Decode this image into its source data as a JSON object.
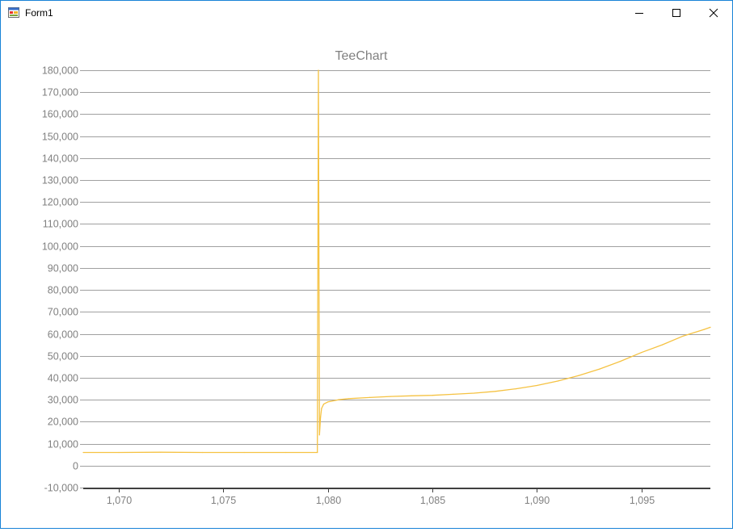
{
  "window": {
    "title": "Form1",
    "icon": "winforms-app-icon",
    "controls": [
      "minimize-icon",
      "maximize-icon",
      "close-icon"
    ],
    "border_color": "#1883d7"
  },
  "chart_data": {
    "type": "line",
    "title": "TeeChart",
    "xlabel": "",
    "ylabel": "",
    "xlim": [
      1068.3,
      1098.3
    ],
    "ylim": [
      -10000,
      180000
    ],
    "x_ticks": [
      1070,
      1075,
      1080,
      1085,
      1090,
      1095
    ],
    "x_tick_labels": [
      "1,070",
      "1,075",
      "1,080",
      "1,085",
      "1,090",
      "1,095"
    ],
    "y_ticks": [
      -10000,
      0,
      10000,
      20000,
      30000,
      40000,
      50000,
      60000,
      70000,
      80000,
      90000,
      100000,
      110000,
      120000,
      130000,
      140000,
      150000,
      160000,
      170000,
      180000
    ],
    "y_tick_labels": [
      "-10,000",
      "0",
      "10,000",
      "20,000",
      "30,000",
      "40,000",
      "50,000",
      "60,000",
      "70,000",
      "80,000",
      "90,000",
      "100,000",
      "110,000",
      "120,000",
      "130,000",
      "140,000",
      "150,000",
      "160,000",
      "170,000",
      "180,000"
    ],
    "grid": "horizontal",
    "legend": "none",
    "series_color": "#f5c242",
    "grid_color": "#a0a0a0",
    "axis_label_color": "#808080",
    "series": [
      {
        "x": [
          1068.3,
          1070,
          1072,
          1074,
          1076,
          1078,
          1079.5,
          1079.55,
          1079.6,
          1079.65,
          1079.7,
          1079.8,
          1080,
          1080.5,
          1081,
          1082,
          1083,
          1084,
          1085,
          1086,
          1087,
          1088,
          1089,
          1090,
          1091,
          1092,
          1093,
          1094,
          1095,
          1096,
          1097,
          1098,
          1098.3
        ],
        "y": [
          6000,
          6000,
          6100,
          6000,
          6000,
          6000,
          6000,
          180000,
          14000,
          22000,
          26000,
          28000,
          29000,
          30000,
          30500,
          31000,
          31500,
          31800,
          32000,
          32500,
          33000,
          33800,
          35000,
          36500,
          38500,
          41000,
          44000,
          47500,
          51500,
          55000,
          59000,
          62000,
          63000
        ]
      }
    ]
  }
}
